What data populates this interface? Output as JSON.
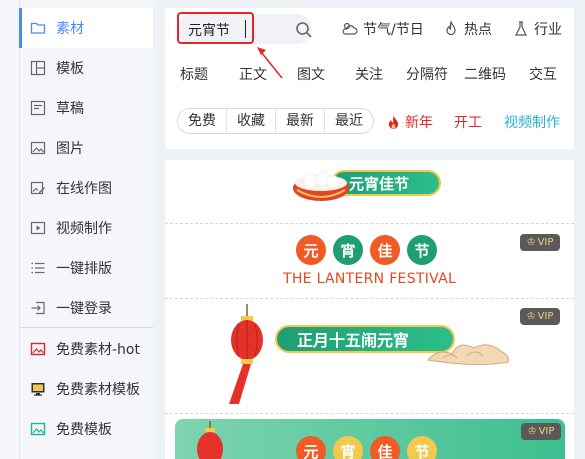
{
  "sidebar": {
    "items": [
      {
        "label": "素材",
        "icon": "folder-icon"
      },
      {
        "label": "模板",
        "icon": "template-icon"
      },
      {
        "label": "草稿",
        "icon": "draft-icon"
      },
      {
        "label": "图片",
        "icon": "image-icon"
      },
      {
        "label": "在线作图",
        "icon": "edit-image-icon"
      },
      {
        "label": "视频制作",
        "icon": "video-icon"
      },
      {
        "label": "一键排版",
        "icon": "list-icon"
      },
      {
        "label": "一键登录",
        "icon": "login-icon"
      },
      {
        "label": "免费素材-hot",
        "icon": "hot-image-icon"
      },
      {
        "label": "免费素材模板",
        "icon": "monitor-icon"
      },
      {
        "label": "免费模板",
        "icon": "teal-image-icon"
      }
    ]
  },
  "search": {
    "value": "元宵节"
  },
  "topnav": {
    "festival": "节气/节日",
    "hot": "热点",
    "industry": "行业"
  },
  "categories": [
    "标题",
    "正文",
    "图文",
    "关注",
    "分隔符",
    "二维码",
    "交互"
  ],
  "filters": [
    "免费",
    "收藏",
    "最新",
    "最近"
  ],
  "tags": {
    "new_year": "新年",
    "start_work": "开工",
    "video": "视频制作"
  },
  "cards": {
    "card1_title": "元宵佳节",
    "card2_chars": [
      "元",
      "宵",
      "佳",
      "节"
    ],
    "card2_sub": "THE LANTERN FESTIVAL",
    "card3_title": "正月十五闹元宵",
    "card4_chars": [
      "元",
      "宵",
      "佳",
      "节"
    ],
    "vip_label": "VIP"
  },
  "colors": {
    "accent": "#4a8cf0",
    "red": "#e3262b",
    "teal": "#2bb3d6",
    "green": "#1f9e74"
  }
}
